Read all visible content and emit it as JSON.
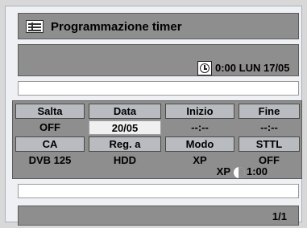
{
  "header": {
    "title": "Programmazione timer"
  },
  "status": {
    "time": "0:00",
    "date": "LUN 17/05"
  },
  "grid": {
    "row1_headers": [
      "Salta",
      "Data",
      "Inizio",
      "Fine"
    ],
    "row1_values": [
      "OFF",
      "20/05",
      "--:--",
      "--:--"
    ],
    "row2_headers": [
      "CA",
      "Reg. a",
      "Modo",
      "STTL"
    ],
    "row2_values": [
      "DVB 125",
      "HDD",
      "XP",
      "OFF"
    ],
    "mode_info": {
      "mode": "XP",
      "duration": "1:00"
    }
  },
  "footer": {
    "page": "1/1"
  }
}
